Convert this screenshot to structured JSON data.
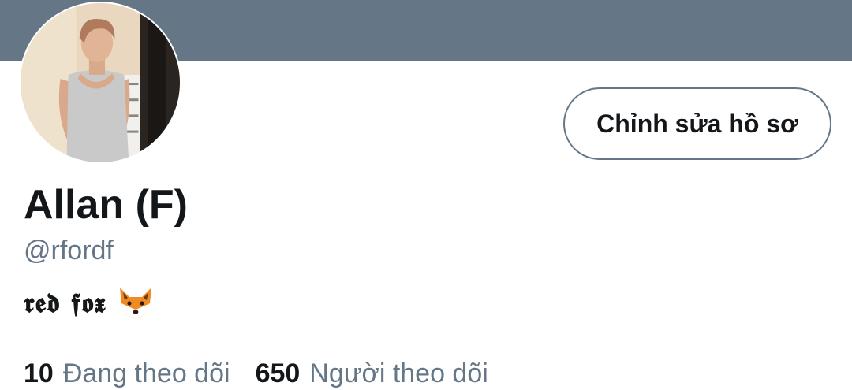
{
  "profile": {
    "display_name": "Allan (F)",
    "handle": "@rfordf",
    "bio_text": "𝖗𝖊𝖉 𝖋𝖔𝖝",
    "bio_emoji": "fox-face-icon"
  },
  "actions": {
    "edit_profile_label": "Chỉnh sửa hồ sơ"
  },
  "stats": {
    "following_count": "10",
    "following_label": "Đang theo dõi",
    "followers_count": "650",
    "followers_label": "Người theo dõi"
  },
  "colors": {
    "banner": "#657786",
    "text_primary": "#14171a",
    "text_secondary": "#657786",
    "button_border": "#657786"
  }
}
